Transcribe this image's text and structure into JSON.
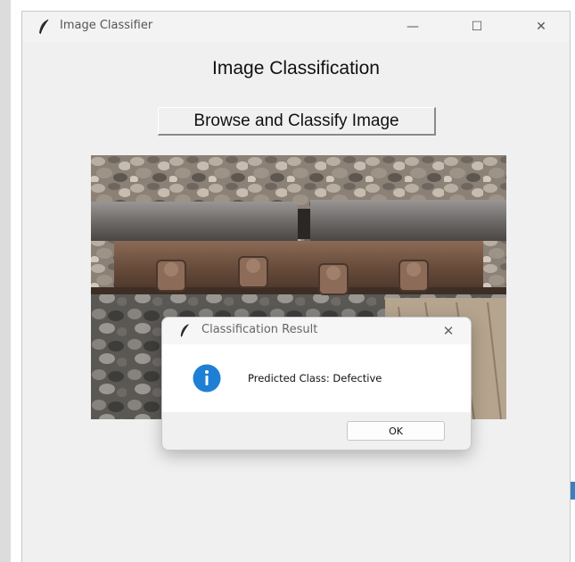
{
  "window": {
    "title": "Image Classifier",
    "controls": {
      "minimize": "—",
      "maximize": "☐",
      "close": "✕"
    }
  },
  "main": {
    "heading": "Image Classification",
    "browse_label": "Browse and Classify Image",
    "image_icon": "rail-joint-photo"
  },
  "dialog": {
    "title": "Classification Result",
    "close": "✕",
    "icon": "info-icon",
    "message": "Predicted Class: Defective",
    "ok_label": "OK"
  },
  "colors": {
    "window_bg": "#f0f0f0",
    "info_blue": "#1f7fd4",
    "dialog_body": "#ffffff"
  }
}
